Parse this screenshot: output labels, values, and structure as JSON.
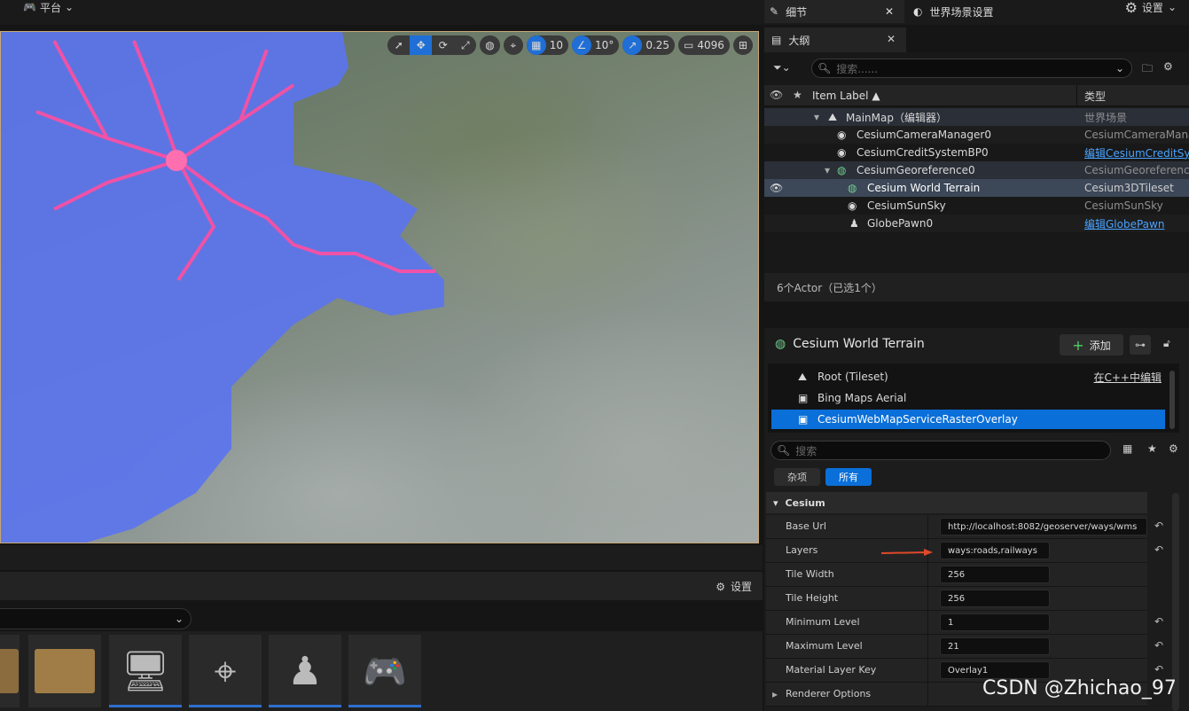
{
  "topbar": {
    "platform_label": "平台",
    "settings_label": "设置"
  },
  "viewport_toolbar": {
    "grid_snap_value": "10",
    "rotation_snap_value": "10°",
    "scale_snap_value": "0.25",
    "camera_speed_value": "4096"
  },
  "content_browser": {
    "settings_label": "设置"
  },
  "outliner": {
    "tab_title": "大纲",
    "search_placeholder": "搜索......",
    "col_label": "Item Label ▲",
    "col_type": "类型",
    "rows": [
      {
        "label": "MainMap（编辑器）",
        "type": "世界场景"
      },
      {
        "label": "CesiumCameraManager0",
        "type": "CesiumCameraManager"
      },
      {
        "label": "CesiumCreditSystemBP0",
        "type": "编辑CesiumCreditSystem"
      },
      {
        "label": "CesiumGeoreference0",
        "type": "CesiumGeoreference"
      },
      {
        "label": "Cesium World Terrain",
        "type": "Cesium3DTileset"
      },
      {
        "label": "CesiumSunSky",
        "type": "CesiumSunSky"
      },
      {
        "label": "GlobePawn0",
        "type": "编辑GlobePawn"
      }
    ],
    "status": "6个Actor（已选1个）"
  },
  "details": {
    "tab_details": "细节",
    "tab_world_settings": "世界场景设置",
    "object_title": "Cesium World Terrain",
    "add_button": "添加",
    "components": [
      {
        "label": "Root (Tileset)",
        "action": "在C++中编辑"
      },
      {
        "label": "Bing Maps Aerial"
      },
      {
        "label": "CesiumWebMapServiceRasterOverlay"
      }
    ],
    "search_placeholder": "搜索",
    "filter_misc": "杂项",
    "filter_all": "所有",
    "category": "Cesium",
    "properties": [
      {
        "name": "Base Url",
        "value": "http://localhost:8082/geoserver/ways/wms"
      },
      {
        "name": "Layers",
        "value": "ways:roads,railways"
      },
      {
        "name": "Tile Width",
        "value": "256"
      },
      {
        "name": "Tile Height",
        "value": "256"
      },
      {
        "name": "Minimum Level",
        "value": "1"
      },
      {
        "name": "Maximum Level",
        "value": "21"
      },
      {
        "name": "Material Layer Key",
        "value": "Overlay1"
      },
      {
        "name": "Renderer Options",
        "value": ""
      }
    ]
  },
  "watermark": "CSDN @Zhichao_97",
  "colors": {
    "accent": "#0a6fd9",
    "overlay_polygon": "#5b74f0",
    "overlay_lines": "#ff4fa0",
    "arrow": "#e0482a"
  }
}
